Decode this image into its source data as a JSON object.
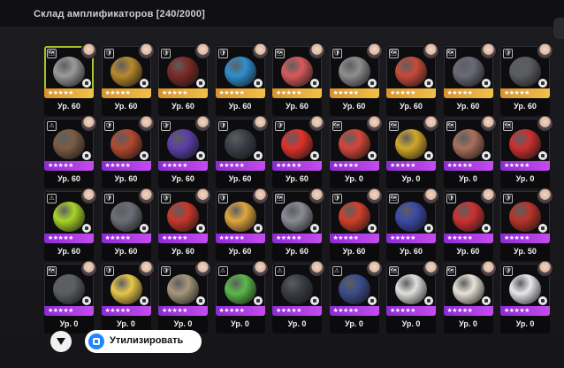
{
  "header": {
    "title": "Склад амплификаторов [240/2000]"
  },
  "items": [
    {
      "level": "Ур. 60",
      "rarity": "gold",
      "color": "#9a9a9a",
      "type": "🗺",
      "selected": true
    },
    {
      "level": "Ур. 60",
      "rarity": "gold",
      "color": "#b7892d",
      "type": "🛡"
    },
    {
      "level": "Ур. 60",
      "rarity": "gold",
      "color": "#7a2a26",
      "type": "🛡"
    },
    {
      "level": "Ур. 60",
      "rarity": "gold",
      "color": "#2f8fd0",
      "type": "🛡"
    },
    {
      "level": "Ур. 60",
      "rarity": "gold",
      "color": "#d85b5b",
      "type": "🗺"
    },
    {
      "level": "Ур. 60",
      "rarity": "gold",
      "color": "#8e8e8e",
      "type": "🛡"
    },
    {
      "level": "Ур. 60",
      "rarity": "gold",
      "color": "#c84b3a",
      "type": "🗺"
    },
    {
      "level": "Ур. 60",
      "rarity": "gold",
      "color": "#6a6a78",
      "type": "🗺"
    },
    {
      "level": "Ур. 60",
      "rarity": "gold",
      "color": "#5a5c60",
      "type": "🛡"
    },
    {
      "level": "Ур. 60",
      "rarity": "purple",
      "color": "#7b5c44",
      "type": "⚠"
    },
    {
      "level": "Ур. 60",
      "rarity": "purple",
      "color": "#b24a2e",
      "type": "🛡"
    },
    {
      "level": "Ур. 60",
      "rarity": "purple",
      "color": "#5c3fa8",
      "type": "🛡"
    },
    {
      "level": "Ур. 60",
      "rarity": "purple",
      "color": "#3b3f48",
      "type": "🛡"
    },
    {
      "level": "Ур. 60",
      "rarity": "purple",
      "color": "#e0322a",
      "type": "🛡"
    },
    {
      "level": "Ур. 0",
      "rarity": "purple",
      "color": "#d5463a",
      "type": "🗺"
    },
    {
      "level": "Ур. 0",
      "rarity": "purple",
      "color": "#d2a82a",
      "type": "🗺"
    },
    {
      "level": "Ур. 0",
      "rarity": "purple",
      "color": "#a9705c",
      "type": "🗺"
    },
    {
      "level": "Ур. 0",
      "rarity": "purple",
      "color": "#cc3030",
      "type": "🗺"
    },
    {
      "level": "Ур. 60",
      "rarity": "purple",
      "color": "#a8d42a",
      "type": "⚠"
    },
    {
      "level": "Ур. 60",
      "rarity": "purple",
      "color": "#6d6f78",
      "type": "🛡"
    },
    {
      "level": "Ур. 60",
      "rarity": "purple",
      "color": "#c8382a",
      "type": "🛡"
    },
    {
      "level": "Ур. 60",
      "rarity": "purple",
      "color": "#e0a640",
      "type": "🛡"
    },
    {
      "level": "Ур. 60",
      "rarity": "purple",
      "color": "#8a8c96",
      "type": "🗺"
    },
    {
      "level": "Ур. 60",
      "rarity": "purple",
      "color": "#d0402a",
      "type": "🛡"
    },
    {
      "level": "Ур. 60",
      "rarity": "purple",
      "color": "#3a4aa8",
      "type": "🗺"
    },
    {
      "level": "Ур. 60",
      "rarity": "purple",
      "color": "#cf3232",
      "type": "🛡"
    },
    {
      "level": "Ур. 50",
      "rarity": "purple",
      "color": "#b8342a",
      "type": "🛡"
    },
    {
      "level": "Ур. 0",
      "rarity": "purple",
      "color": "#5a5f62",
      "type": "🗺"
    },
    {
      "level": "Ур. 0",
      "rarity": "purple",
      "color": "#e8c84a",
      "type": "🛡"
    },
    {
      "level": "Ур. 0",
      "rarity": "purple",
      "color": "#a6977c",
      "type": "🛡"
    },
    {
      "level": "Ур. 0",
      "rarity": "purple",
      "color": "#5bb84a",
      "type": "⚠"
    },
    {
      "level": "Ур. 0",
      "rarity": "purple",
      "color": "#3a3c44",
      "type": "⚠"
    },
    {
      "level": "Ур. 0",
      "rarity": "purple",
      "color": "#3b4d8a",
      "type": "⚠"
    },
    {
      "level": "Ур. 0",
      "rarity": "purple",
      "color": "#e0e0dc",
      "type": "🗺"
    },
    {
      "level": "Ур. 0",
      "rarity": "purple",
      "color": "#e8e2d8",
      "type": "🗺"
    },
    {
      "level": "Ур. 0",
      "rarity": "purple",
      "color": "#e8e8ec",
      "type": "🛡"
    }
  ],
  "stars_text": "★★★★★",
  "footer": {
    "utilize_label": "Утилизировать"
  }
}
